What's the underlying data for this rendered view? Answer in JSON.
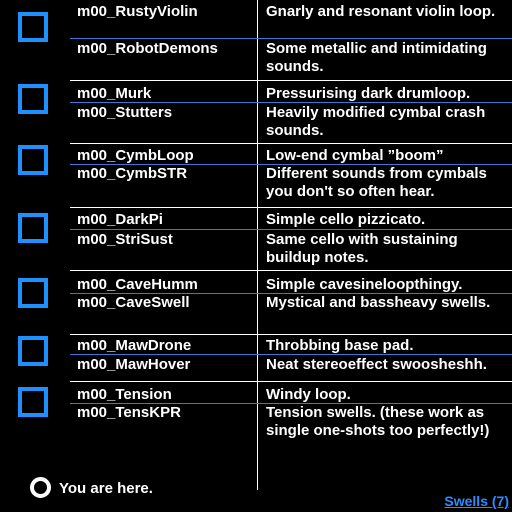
{
  "groups": [
    {
      "rows": [
        {
          "name": "m00_RustyViolin",
          "desc": "Gnarly and resonant violin loop."
        },
        {
          "name": "m00_RobotDemons",
          "desc": "Some metallic and intimidating sounds."
        }
      ]
    },
    {
      "rows": [
        {
          "name": "m00_Murk",
          "desc": "Pressurising dark drumloop."
        },
        {
          "name": "m00_Stutters",
          "desc": "Heavily modified cymbal crash sounds."
        }
      ]
    },
    {
      "rows": [
        {
          "name": "m00_CymbLoop",
          "desc": "Low-end cymbal ”boom”"
        },
        {
          "name": "m00_CymbSTR",
          "desc": "Different sounds from cymbals you don't so often hear."
        }
      ]
    },
    {
      "rows": [
        {
          "name": "m00_DarkPi",
          "desc": "Simple cello pizzicato."
        },
        {
          "name": "m00_StriSust",
          "desc": "Same cello with sustaining buildup notes."
        }
      ]
    },
    {
      "rows": [
        {
          "name": "m00_CaveHumm",
          "desc": "Simple cavesineloopthingy."
        },
        {
          "name": "m00_CaveSwell",
          "desc": "Mystical and bassheavy swells."
        }
      ]
    },
    {
      "rows": [
        {
          "name": "m00_MawDrone",
          "desc": "Throbbing base pad."
        },
        {
          "name": "m00_MawHover",
          "desc": "Neat stereoeffect swoosheshh."
        }
      ]
    },
    {
      "rows": [
        {
          "name": "m00_Tension",
          "desc": "Windy loop."
        },
        {
          "name": "m00_TensKPR",
          "desc": "Tension swells. (these work as single one-shots too perfectly!)"
        }
      ]
    }
  ],
  "footer": {
    "here_label": "You are here.",
    "nav_link": "Swells (7)"
  },
  "colors": {
    "accent": "#1e90ff",
    "link": "#2f8cff",
    "background": "#000000",
    "text": "#ffffff"
  }
}
